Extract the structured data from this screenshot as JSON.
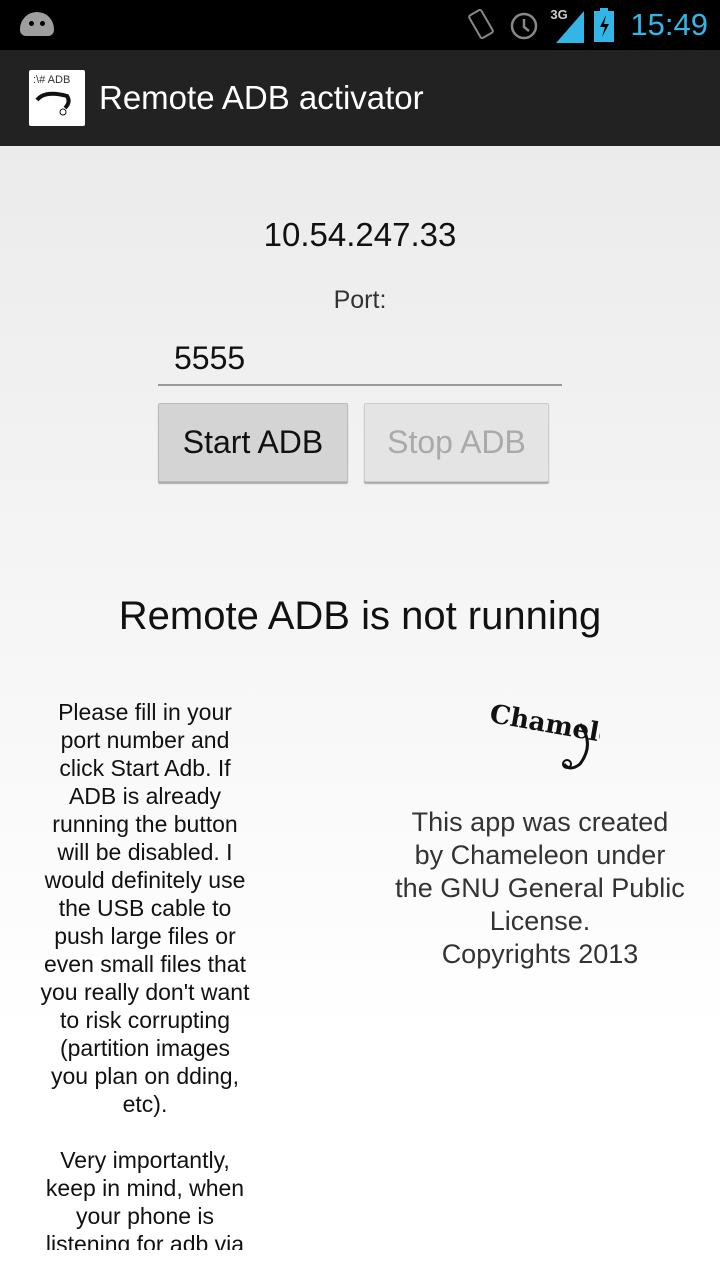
{
  "status_bar": {
    "time": "15:49",
    "network": "3G",
    "icons": [
      "android-debug-icon",
      "rotate-icon",
      "alarm-icon",
      "signal-icon",
      "battery-charging-icon"
    ],
    "accent": "#33b5e5"
  },
  "action_bar": {
    "title": "Remote ADB activator",
    "icon_text": ":\\# ADB"
  },
  "main": {
    "ip": "10.54.247.33",
    "port_label": "Port:",
    "port_value": "5555",
    "start_label": "Start ADB",
    "stop_label": "Stop ADB",
    "status": "Remote ADB is not running",
    "help_lines": [
      "Please fill in your",
      "port number and",
      "click Start Adb. If",
      "ADB is already",
      "running the button",
      "will be disabled. I",
      "would definitely use",
      "the USB cable to",
      "push large files or",
      "even small files that",
      "you really don't want",
      "to risk corrupting",
      "(partition images",
      "you plan on dding,",
      "etc)."
    ],
    "help_lines_2": [
      "Very importantly,",
      "keep in mind, when",
      "your phone is",
      "listening for adb via"
    ],
    "logo_text": "Chameleon",
    "about_lines": [
      "This app was created",
      "by Chameleon under",
      "the GNU General Public",
      "License.",
      "Copyrights 2013"
    ]
  }
}
